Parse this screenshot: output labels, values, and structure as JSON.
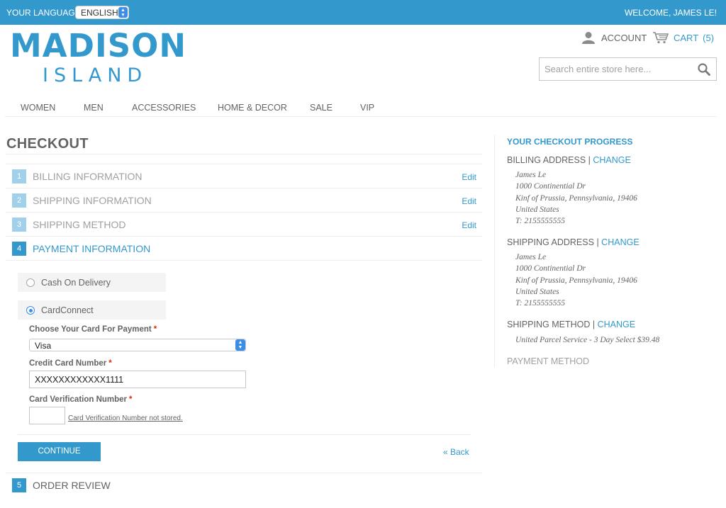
{
  "topbar": {
    "language_label": "Your Language:",
    "language_value": "English",
    "welcome": "Welcome, James Le!"
  },
  "header": {
    "logo_main": "MADISON",
    "logo_sub": "ISLAND",
    "account_label": "Account",
    "cart_label": "Cart",
    "cart_count": "(5)",
    "search_placeholder": "Search entire store here..."
  },
  "nav": {
    "items": [
      "Women",
      "Men",
      "Accessories",
      "Home & Decor",
      "Sale",
      "VIP"
    ]
  },
  "checkout": {
    "title": "CHECKOUT",
    "steps": [
      {
        "num": "1",
        "label": "Billing Information",
        "edit": "Edit"
      },
      {
        "num": "2",
        "label": "Shipping Information",
        "edit": "Edit"
      },
      {
        "num": "3",
        "label": "Shipping Method",
        "edit": "Edit"
      },
      {
        "num": "4",
        "label": "Payment Information"
      },
      {
        "num": "5",
        "label": "Order Review"
      }
    ],
    "payment_methods": [
      {
        "label": "Cash On Delivery",
        "selected": false
      },
      {
        "label": "CardConnect",
        "selected": true
      }
    ],
    "card_type_label": "Choose Your Card For Payment",
    "card_type_value": "Visa",
    "cc_number_label": "Credit Card Number",
    "cc_number_value": "XXXXXXXXXXXX1111",
    "cvv_label": "Card Verification Number",
    "cvv_note": "Card Verification Number not stored.",
    "required_mark": "*",
    "continue_label": "Continue",
    "back_label": "« Back"
  },
  "progress": {
    "title": "Your Checkout Progress",
    "separator": "|",
    "change_label": "Change",
    "billing_head": "Billing Address",
    "billing_lines": [
      "James Le",
      "1000 Continential Dr",
      "Kinf of Prussia, Pennsylvania, 19406",
      "United States",
      "T: 2155555555"
    ],
    "shipping_head": "Shipping Address",
    "shipping_lines": [
      "James Le",
      "1000 Continential Dr",
      "Kinf of Prussia, Pennsylvania, 19406",
      "United States",
      "T: 2155555555"
    ],
    "method_head": "Shipping Method",
    "method_line": "United Parcel Service - 3 Day Select $39.48",
    "payment_head": "Payment Method"
  },
  "colors": {
    "accent": "#3399cc",
    "text": "#636363",
    "muted": "#a0a0a0",
    "required": "#df280a"
  }
}
